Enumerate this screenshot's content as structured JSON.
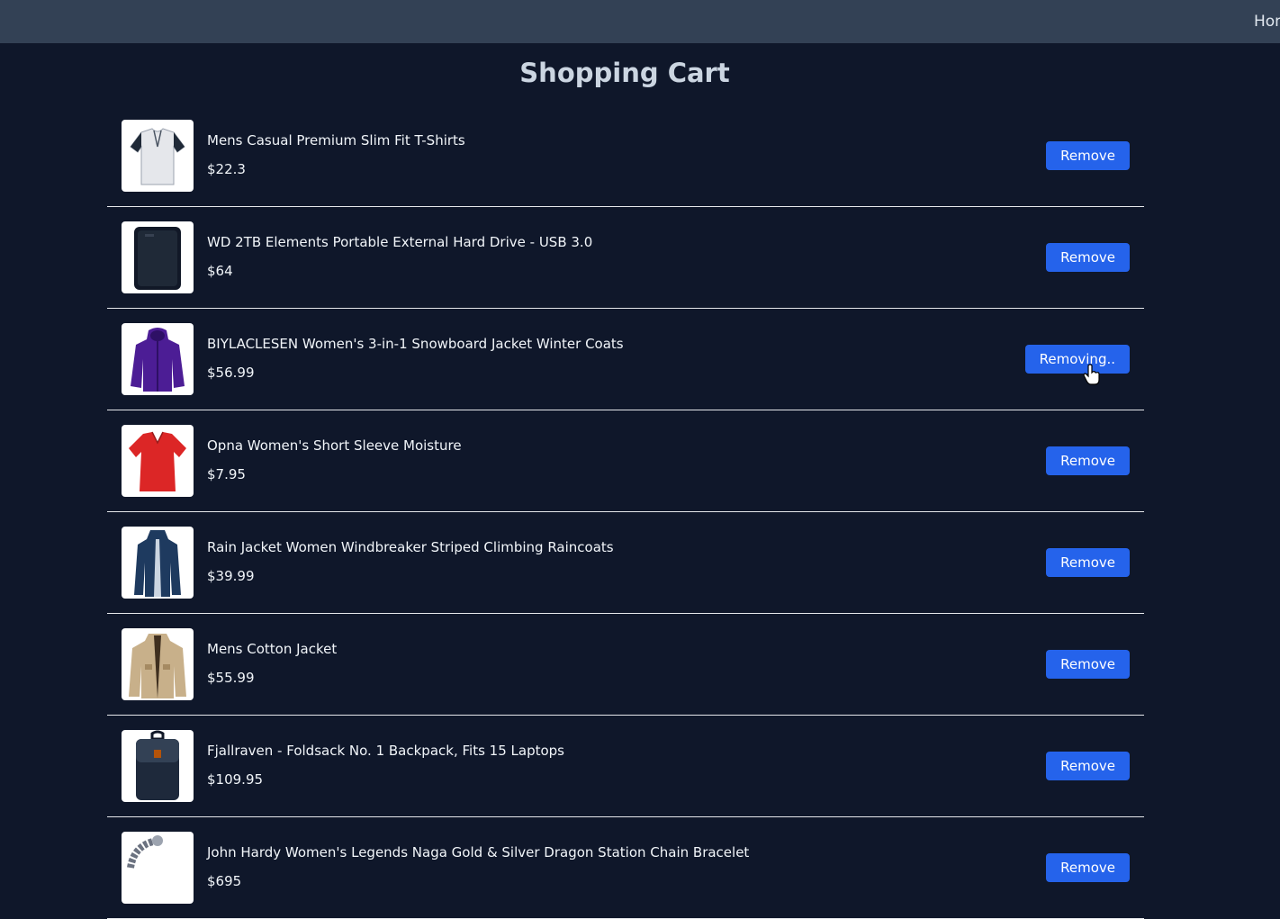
{
  "nav": {
    "home_label": "Home"
  },
  "page": {
    "title": "Shopping Cart"
  },
  "accent_color": "#2563eb",
  "cart": {
    "items": [
      {
        "name": "Mens Casual Premium Slim Fit T-Shirts",
        "price": "$22.3",
        "button": "Remove",
        "image_icon": "tshirt-icon"
      },
      {
        "name": "WD 2TB Elements Portable External Hard Drive - USB 3.0",
        "price": "$64",
        "button": "Remove",
        "image_icon": "hard-drive-icon"
      },
      {
        "name": "BIYLACLESEN Women's 3-in-1 Snowboard Jacket Winter Coats",
        "price": "$56.99",
        "button": "Removing..",
        "image_icon": "purple-jacket-icon"
      },
      {
        "name": "Opna Women's Short Sleeve Moisture",
        "price": "$7.95",
        "button": "Remove",
        "image_icon": "red-shirt-icon"
      },
      {
        "name": "Rain Jacket Women Windbreaker Striped Climbing Raincoats",
        "price": "$39.99",
        "button": "Remove",
        "image_icon": "navy-coat-icon"
      },
      {
        "name": "Mens Cotton Jacket",
        "price": "$55.99",
        "button": "Remove",
        "image_icon": "khaki-jacket-icon"
      },
      {
        "name": "Fjallraven - Foldsack No. 1 Backpack, Fits 15 Laptops",
        "price": "$109.95",
        "button": "Remove",
        "image_icon": "backpack-icon"
      },
      {
        "name": "John Hardy Women's Legends Naga Gold & Silver Dragon Station Chain Bracelet",
        "price": "$695",
        "button": "Remove",
        "image_icon": "bracelet-icon"
      }
    ]
  }
}
